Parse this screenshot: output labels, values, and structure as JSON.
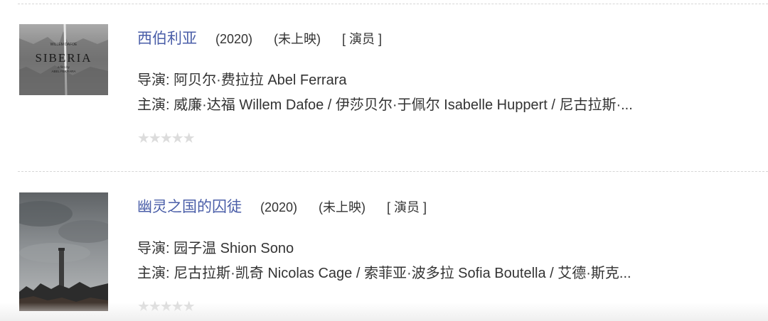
{
  "movies": [
    {
      "title": "西伯利亚",
      "year": "(2020)",
      "status": "(未上映)",
      "role": "[ 演员 ]",
      "director": "导演: 阿贝尔·费拉拉 Abel Ferrara",
      "cast": "主演: 威廉·达福 Willem Dafoe / 伊莎贝尔·于佩尔 Isabelle Huppert / 尼古拉斯·...",
      "rating_stars": 0,
      "poster": {
        "actor": "WILLEM DAFOE",
        "title": "SIBERIA",
        "credit_line1": "a film by",
        "credit_line2": "ABEL FERRARA"
      }
    },
    {
      "title": "幽灵之国的囚徒",
      "year": "(2020)",
      "status": "(未上映)",
      "role": "[ 演员 ]",
      "director": "导演: 园子温 Shion Sono",
      "cast": "主演: 尼古拉斯·凯奇 Nicolas Cage / 索菲亚·波多拉 Sofia Boutella / 艾德·斯克...",
      "rating_stars": 0,
      "poster": {}
    }
  ],
  "icons": {
    "star": "★★★★★"
  }
}
